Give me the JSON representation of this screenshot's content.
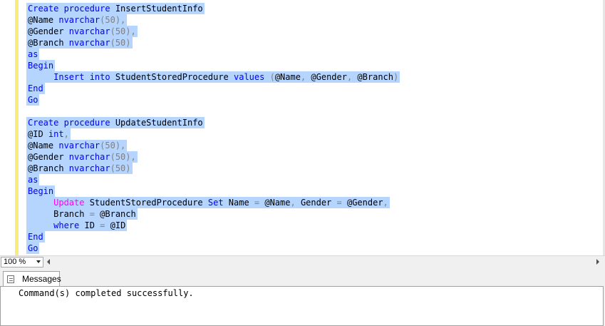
{
  "editor": {
    "lines": [
      [
        {
          "t": "Create procedure ",
          "c": "kw"
        },
        {
          "t": "InsertStudentInfo",
          "c": "plain"
        }
      ],
      [
        {
          "t": "@Name ",
          "c": "plain"
        },
        {
          "t": "nvarchar",
          "c": "kw"
        },
        {
          "t": "(50),",
          "c": "gray"
        }
      ],
      [
        {
          "t": "@Gender ",
          "c": "plain"
        },
        {
          "t": "nvarchar",
          "c": "kw"
        },
        {
          "t": "(50),",
          "c": "gray"
        }
      ],
      [
        {
          "t": "@Branch ",
          "c": "plain"
        },
        {
          "t": "nvarchar",
          "c": "kw"
        },
        {
          "t": "(50)",
          "c": "gray"
        }
      ],
      [
        {
          "t": "as",
          "c": "kw"
        }
      ],
      [
        {
          "t": "Begin",
          "c": "kw"
        }
      ],
      [
        {
          "t": "     ",
          "c": "plain"
        },
        {
          "t": "Insert into ",
          "c": "kw"
        },
        {
          "t": "StudentStoredProcedure ",
          "c": "plain"
        },
        {
          "t": "values ",
          "c": "kw"
        },
        {
          "t": "(",
          "c": "gray"
        },
        {
          "t": "@Name",
          "c": "plain"
        },
        {
          "t": ", ",
          "c": "gray"
        },
        {
          "t": "@Gender",
          "c": "plain"
        },
        {
          "t": ", ",
          "c": "gray"
        },
        {
          "t": "@Branch",
          "c": "plain"
        },
        {
          "t": ")",
          "c": "gray"
        }
      ],
      [
        {
          "t": "End",
          "c": "kw"
        }
      ],
      [
        {
          "t": "Go",
          "c": "kw"
        }
      ],
      [],
      [
        {
          "t": "Create procedure ",
          "c": "kw"
        },
        {
          "t": "UpdateStudentInfo",
          "c": "plain"
        }
      ],
      [
        {
          "t": "@ID ",
          "c": "plain"
        },
        {
          "t": "int",
          "c": "kw"
        },
        {
          "t": ",",
          "c": "gray"
        }
      ],
      [
        {
          "t": "@Name ",
          "c": "plain"
        },
        {
          "t": "nvarchar",
          "c": "kw"
        },
        {
          "t": "(50),",
          "c": "gray"
        }
      ],
      [
        {
          "t": "@Gender ",
          "c": "plain"
        },
        {
          "t": "nvarchar",
          "c": "kw"
        },
        {
          "t": "(50),",
          "c": "gray"
        }
      ],
      [
        {
          "t": "@Branch ",
          "c": "plain"
        },
        {
          "t": "nvarchar",
          "c": "kw"
        },
        {
          "t": "(50)",
          "c": "gray"
        }
      ],
      [
        {
          "t": "as",
          "c": "kw"
        }
      ],
      [
        {
          "t": "Begin",
          "c": "kw"
        }
      ],
      [
        {
          "t": "     ",
          "c": "plain"
        },
        {
          "t": "Update ",
          "c": "pink"
        },
        {
          "t": "StudentStoredProcedure ",
          "c": "plain"
        },
        {
          "t": "Set ",
          "c": "kw"
        },
        {
          "t": "Name ",
          "c": "plain"
        },
        {
          "t": "= ",
          "c": "gray"
        },
        {
          "t": "@Name",
          "c": "plain"
        },
        {
          "t": ", ",
          "c": "gray"
        },
        {
          "t": "Gender ",
          "c": "plain"
        },
        {
          "t": "= ",
          "c": "gray"
        },
        {
          "t": "@Gender",
          "c": "plain"
        },
        {
          "t": ",",
          "c": "gray"
        }
      ],
      [
        {
          "t": "     ",
          "c": "plain"
        },
        {
          "t": "Branch ",
          "c": "plain"
        },
        {
          "t": "= ",
          "c": "gray"
        },
        {
          "t": "@Branch",
          "c": "plain"
        }
      ],
      [
        {
          "t": "     ",
          "c": "plain"
        },
        {
          "t": "where ",
          "c": "kw"
        },
        {
          "t": "ID ",
          "c": "plain"
        },
        {
          "t": "= ",
          "c": "gray"
        },
        {
          "t": "@ID",
          "c": "plain"
        }
      ],
      [
        {
          "t": "End",
          "c": "kw"
        }
      ],
      [
        {
          "t": "Go",
          "c": "kw"
        }
      ]
    ]
  },
  "statusbar": {
    "zoom": "100 %"
  },
  "results": {
    "tab_label": "Messages",
    "message": "Command(s) completed successfully."
  },
  "colors": {
    "keyword": "#0000ff",
    "operator": "#808080",
    "function": "#ff00ff",
    "selection": "#b5d5ff",
    "change_bar": "#f8ec7a"
  }
}
